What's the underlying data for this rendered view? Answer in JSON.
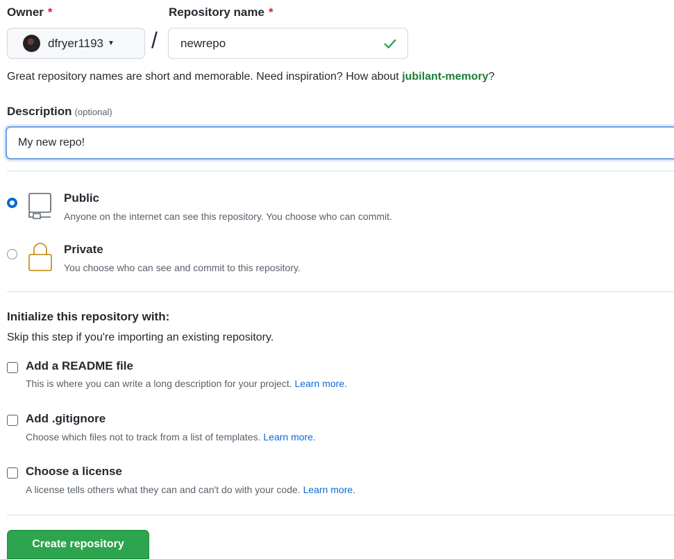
{
  "owner": {
    "label": "Owner",
    "required_mark": "*",
    "value": "dfryer1193"
  },
  "separator": "/",
  "repo_name": {
    "label": "Repository name",
    "required_mark": "*",
    "value": "newrepo"
  },
  "hint": {
    "text": "Great repository names are short and memorable. Need inspiration? How about ",
    "suggestion": "jubilant-memory",
    "suffix": "?"
  },
  "description": {
    "label": "Description",
    "optional": "(optional)",
    "value": "My new repo!"
  },
  "visibility": {
    "public": {
      "title": "Public",
      "desc": "Anyone on the internet can see this repository. You choose who can commit.",
      "selected": true
    },
    "private": {
      "title": "Private",
      "desc": "You choose who can see and commit to this repository.",
      "selected": false
    }
  },
  "init": {
    "title": "Initialize this repository with:",
    "subtitle": "Skip this step if you're importing an existing repository.",
    "options": [
      {
        "title": "Add a README file",
        "desc": "This is where you can write a long description for your project.",
        "link": "Learn more."
      },
      {
        "title": "Add .gitignore",
        "desc": "Choose which files not to track from a list of templates.",
        "link": "Learn more."
      },
      {
        "title": "Choose a license",
        "desc": "A license tells others what they can and can't do with your code.",
        "link": "Learn more."
      }
    ]
  },
  "create_button": "Create repository",
  "colors": {
    "accent": "#0969da",
    "success": "#2da44e",
    "danger": "#cf222e"
  }
}
